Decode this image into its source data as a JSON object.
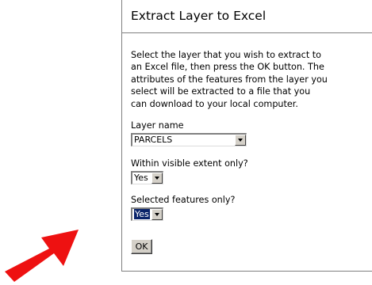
{
  "panel": {
    "title": "Extract Layer to Excel",
    "description_lines": [
      "Select the layer that you wish to extract to",
      "an Excel file, then press the OK button. The",
      "attributes of the features from the layer you",
      "select will be extracted to a file that you",
      "can download to your local computer."
    ]
  },
  "layer_name": {
    "label": "Layer name",
    "value": "PARCELS"
  },
  "visible_extent": {
    "label": "Within visible extent only?",
    "value": "Yes"
  },
  "selected_features": {
    "label": "Selected features only?",
    "value": "Yes"
  },
  "ok_button": {
    "label": "OK"
  },
  "colors": {
    "arrow": "#ee1111",
    "selection_highlight": "#0a246a",
    "button_face": "#d4d0c8"
  },
  "icons": {
    "pointer_arrow": "red-arrow-icon",
    "dropdown": "dropdown-arrow-icon"
  }
}
